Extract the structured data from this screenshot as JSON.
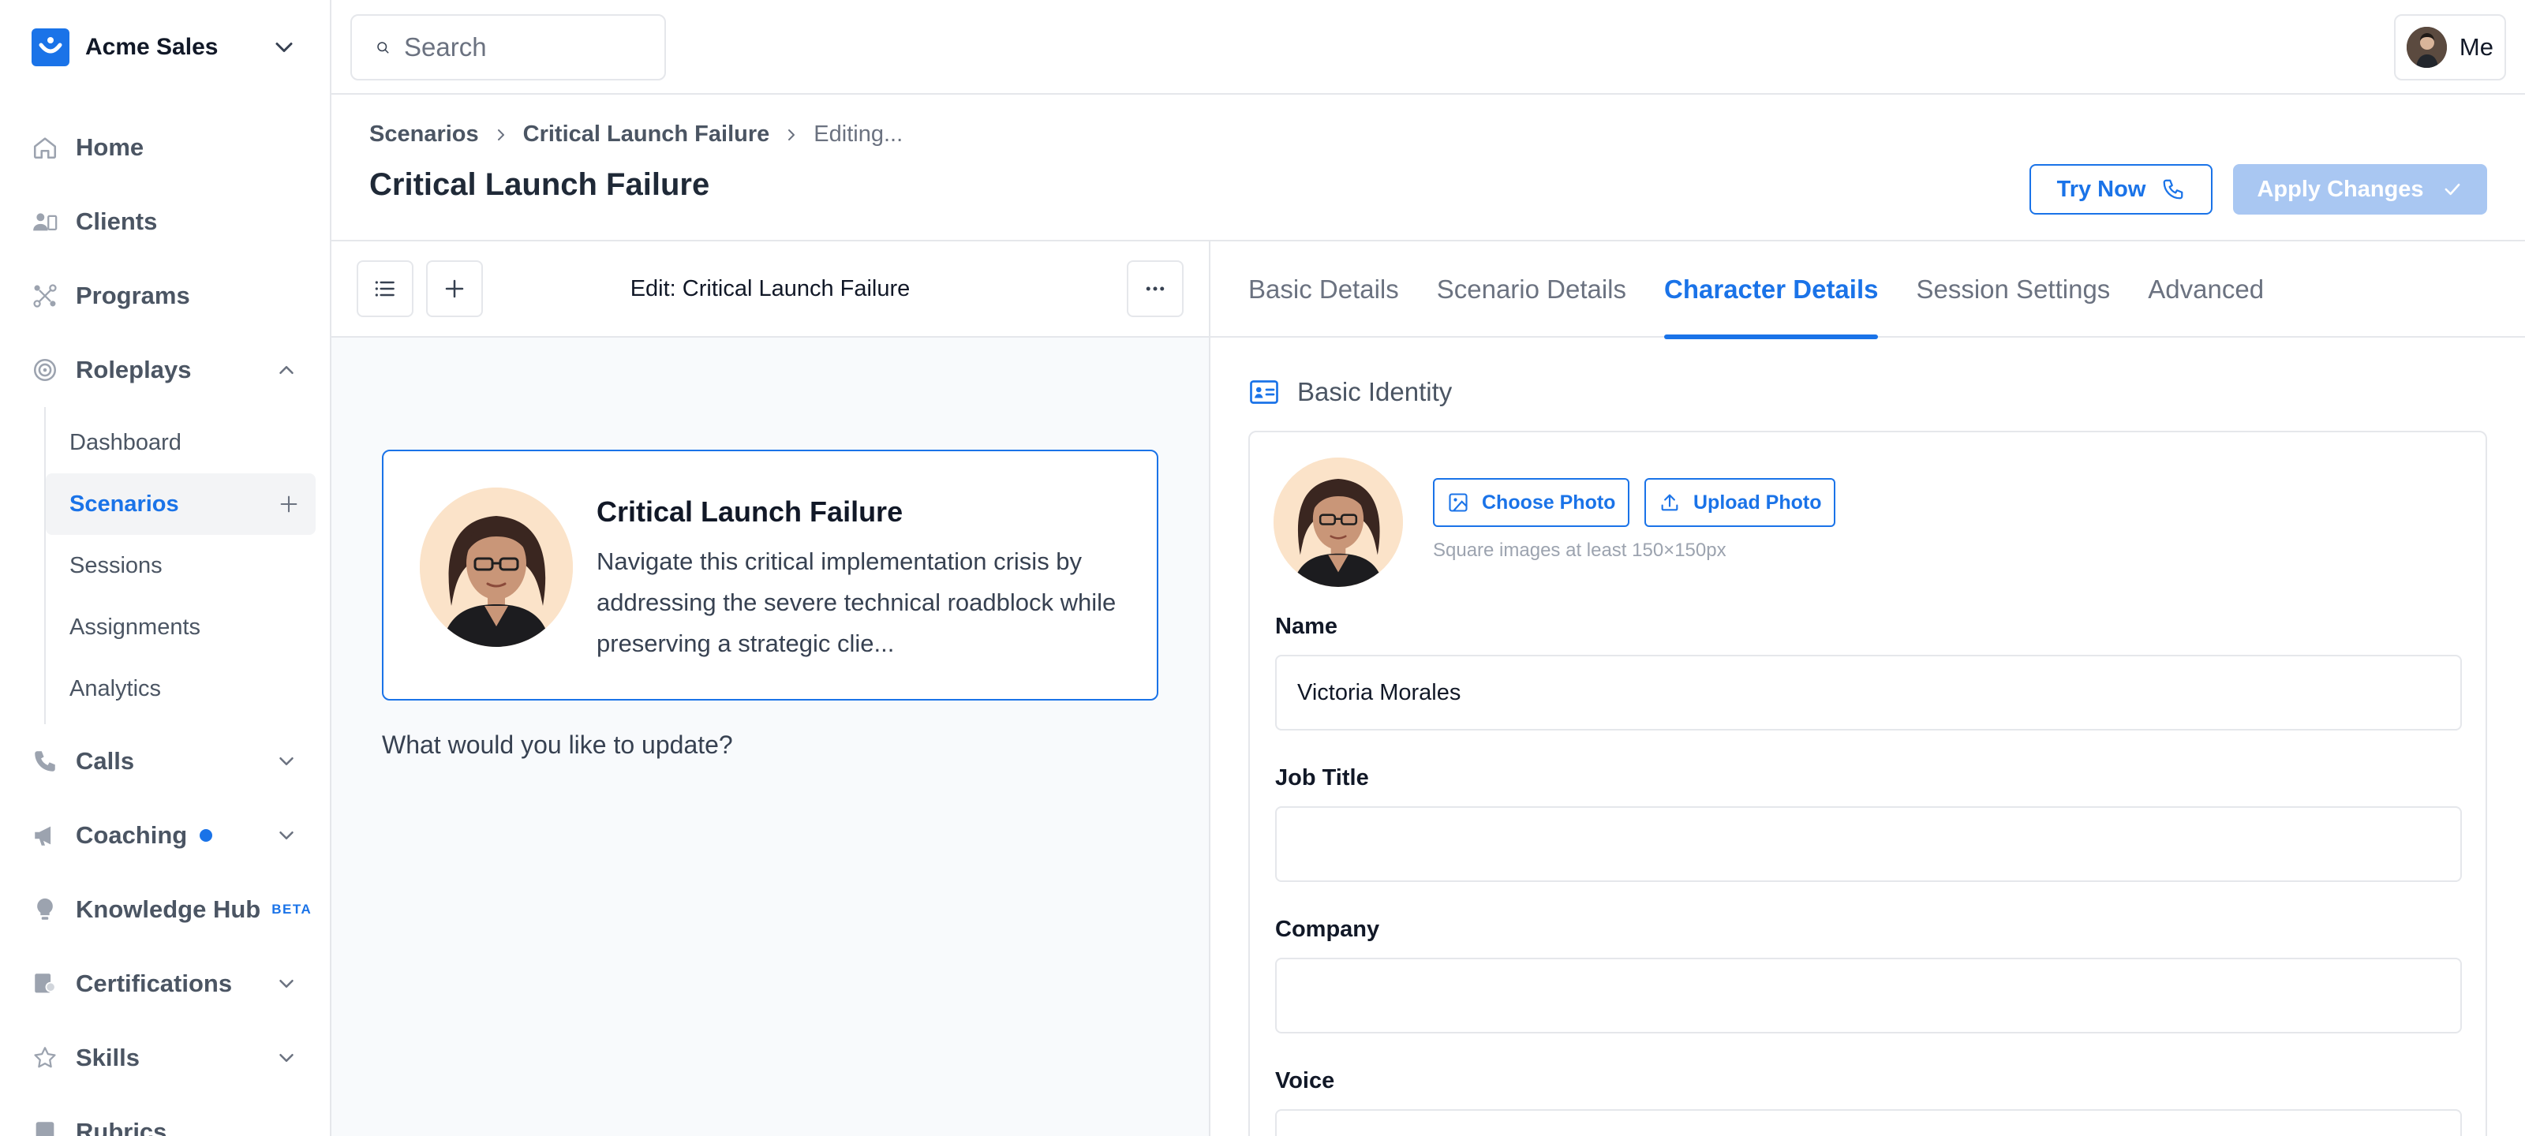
{
  "org": {
    "name": "Acme Sales"
  },
  "search": {
    "placeholder": "Search"
  },
  "user": {
    "label": "Me"
  },
  "sidebar": {
    "items": [
      {
        "label": "Home"
      },
      {
        "label": "Clients"
      },
      {
        "label": "Programs"
      },
      {
        "label": "Roleplays"
      },
      {
        "label": "Calls"
      },
      {
        "label": "Coaching"
      },
      {
        "label": "Knowledge Hub",
        "badge": "BETA"
      },
      {
        "label": "Certifications"
      },
      {
        "label": "Skills"
      },
      {
        "label": "Rubrics"
      }
    ],
    "roleplays_sub": [
      "Dashboard",
      "Scenarios",
      "Sessions",
      "Assignments",
      "Analytics"
    ]
  },
  "breadcrumb": [
    "Scenarios",
    "Critical Launch Failure",
    "Editing..."
  ],
  "page_title": "Critical Launch Failure",
  "actions": {
    "try_now": "Try Now",
    "apply_changes": "Apply Changes"
  },
  "editor": {
    "title": "Edit: Critical Launch Failure",
    "card_title": "Critical Launch Failure",
    "card_description": "Navigate this critical implementation crisis by addressing the severe technical roadblock while preserving a strategic clie...",
    "prompt": "What would you like to update?"
  },
  "tabs": [
    "Basic Details",
    "Scenario Details",
    "Character Details",
    "Session Settings",
    "Advanced"
  ],
  "active_tab": "Character Details",
  "section": {
    "title": "Basic Identity"
  },
  "photo": {
    "choose": "Choose Photo",
    "upload": "Upload Photo",
    "hint": "Square images at least 150×150px"
  },
  "fields": {
    "name": {
      "label": "Name",
      "value": "Victoria Morales"
    },
    "job_title": {
      "label": "Job Title",
      "value": ""
    },
    "company": {
      "label": "Company",
      "value": ""
    },
    "voice": {
      "label": "Voice"
    }
  },
  "colors": {
    "accent": "#1a73e8",
    "apply_disabled": "#a9c7f2",
    "border": "#e5e7eb",
    "panel_bg": "#f8fafc"
  }
}
